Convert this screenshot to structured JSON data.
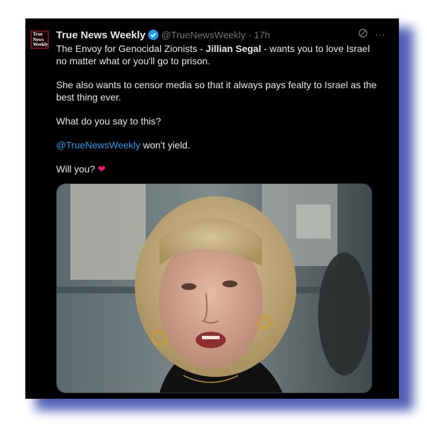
{
  "tweet": {
    "avatar_text": "True News Weekly",
    "display_name": "True News Weekly",
    "handle_time": "@TrueNewsWeekly · 17h",
    "line1_pre": "The Envoy for Genocidal Zionists - ",
    "line1_bold": "Jillian Segal",
    "line1_post": " - wants you to love Israel no matter what or you'll go to prison.",
    "para2": "She also wants to censor media so that it always pays fealty to Israel as the best thing ever.",
    "para3": "What do you say to this?",
    "mention": "@TrueNewsWeekly",
    "para4_post": " won't yield.",
    "para5": "Will you?",
    "heart": "❤",
    "more": "···"
  },
  "colors": {
    "background": "#000000",
    "text": "#e7e9ea",
    "muted": "#71767b",
    "link": "#1d9bf0",
    "verified": "#1d9bf0",
    "heart": "#f91880",
    "frame_shadow": "#3d4fae"
  }
}
